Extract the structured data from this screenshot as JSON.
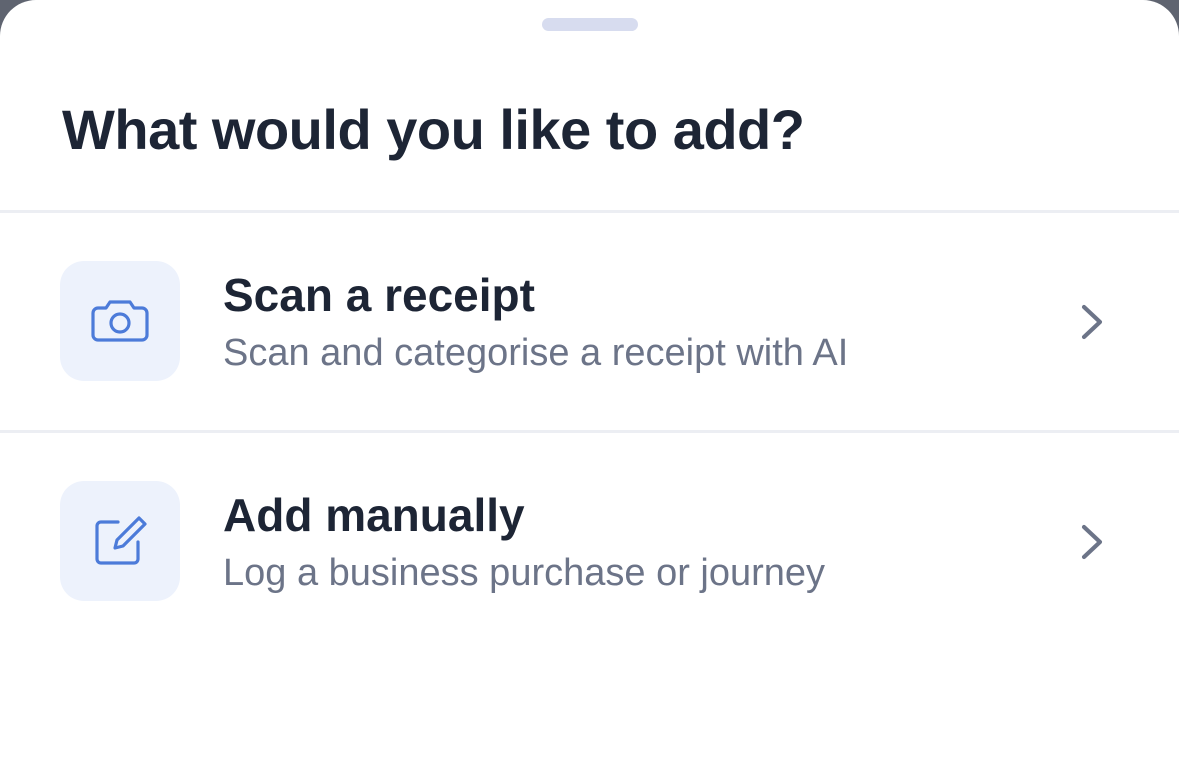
{
  "sheet": {
    "title": "What would you like to add?"
  },
  "options": [
    {
      "icon": "camera-icon",
      "title": "Scan a receipt",
      "subtitle": "Scan and categorise a receipt with AI"
    },
    {
      "icon": "edit-icon",
      "title": "Add manually",
      "subtitle": "Log a business purchase or journey"
    }
  ],
  "colors": {
    "title_text": "#1d2535",
    "subtitle_text": "#6c7488",
    "icon_tile_bg": "#edf2fc",
    "icon_accent": "#4c7bd9",
    "grabber": "#d7dcef",
    "divider": "#eceef3"
  }
}
